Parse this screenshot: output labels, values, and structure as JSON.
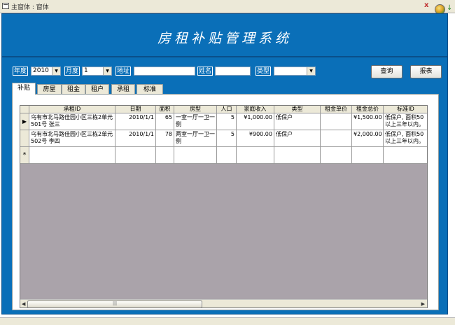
{
  "window": {
    "title": "主窗体 : 窗体",
    "close_label": "x"
  },
  "header": {
    "app_title": "房租补贴管理系统"
  },
  "filters": {
    "year_label": "年度",
    "year_value": "2010",
    "month_label": "月度",
    "month_value": "1",
    "address_label": "地址",
    "address_value": "",
    "name_label": "姓名",
    "name_value": "",
    "type_label": "类型",
    "type_value": ""
  },
  "buttons": {
    "query": "查询",
    "report": "报表"
  },
  "tabs": [
    "补贴",
    "房屋",
    "租金",
    "租户",
    "承租",
    "标准"
  ],
  "table": {
    "columns": [
      "承租ID",
      "日期",
      "面积",
      "房型",
      "人口",
      "家庭收入",
      "类型",
      "租金单价",
      "租金总价",
      "标准ID"
    ],
    "rows": [
      [
        "乌有市北马路佳园小区三栋2单元501号 张三",
        "2010/1/1",
        "65",
        "一室一厅一卫一侧",
        "5",
        "¥1,000.00",
        "低保户",
        "",
        "¥1,500.00",
        "低保户, 面积50以上三年以内。"
      ],
      [
        "乌有市北马路佳园小区三栋2单元502号 李四",
        "2010/1/1",
        "78",
        "两室一厅一卫一侧",
        "5",
        "¥900.00",
        "低保户",
        "",
        "¥2,000.00",
        "低保户, 面积50以上三年以内。"
      ]
    ],
    "current_row_marker": "▶",
    "new_row_marker": "*"
  },
  "scrollbar": {
    "left_arrow": "◀",
    "right_arrow": "▶",
    "thumb_grip": "|||"
  },
  "icons": {
    "window_icon": "window-icon",
    "globe": "globe-icon",
    "download": "download-arrow-icon"
  }
}
